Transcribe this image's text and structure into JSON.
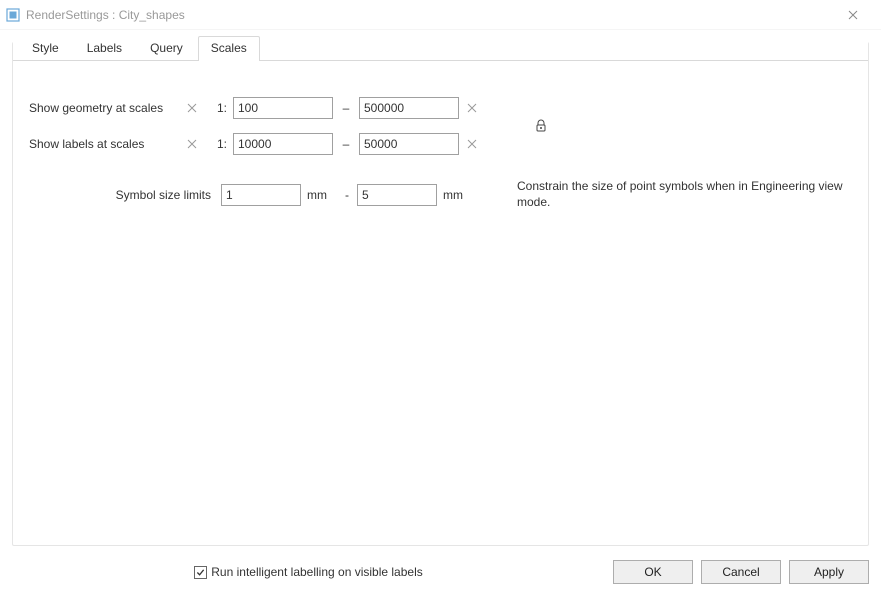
{
  "window": {
    "title": "RenderSettings : City_shapes"
  },
  "tabs": {
    "style": "Style",
    "labels": "Labels",
    "query": "Query",
    "scales": "Scales",
    "active": "scales"
  },
  "scales": {
    "geometry_label": "Show geometry at scales",
    "labels_label": "Show labels at scales",
    "one_prefix": "1:",
    "geometry_min": "100",
    "geometry_max": "500000",
    "labels_min": "10000",
    "labels_max": "50000",
    "dash": "–",
    "symbol_label": "Symbol size limits",
    "symbol_min": "1",
    "symbol_max": "5",
    "unit_mm": "mm",
    "hyphen": "-",
    "hint": "Constrain the size of point symbols\nwhen in Engineering view mode."
  },
  "footer": {
    "checkbox_label": "Run intelligent labelling on visible labels",
    "checkbox_checked": true,
    "ok": "OK",
    "cancel": "Cancel",
    "apply": "Apply"
  }
}
